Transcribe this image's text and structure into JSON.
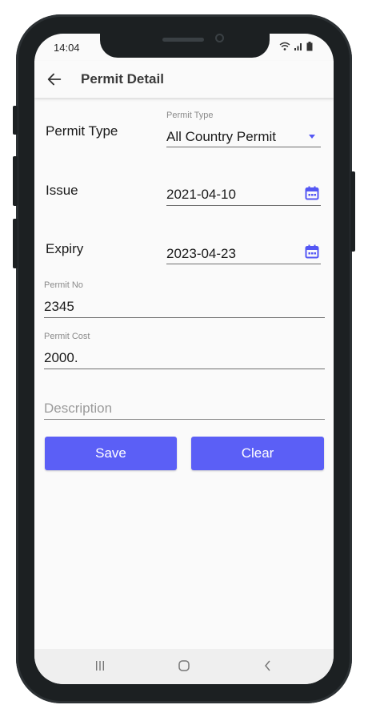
{
  "status": {
    "time": "14:04"
  },
  "appbar": {
    "title": "Permit Detail"
  },
  "form": {
    "permit_type": {
      "label": "Permit Type",
      "caption": "Permit Type",
      "value": "All Country Permit"
    },
    "issue": {
      "label": "Issue",
      "value": "2021-04-10"
    },
    "expiry": {
      "label": "Expiry",
      "value": "2023-04-23"
    },
    "permit_no": {
      "caption": "Permit No",
      "value": "2345"
    },
    "permit_cost": {
      "caption": "Permit Cost",
      "value": "2000."
    },
    "description": {
      "placeholder": "Description",
      "value": ""
    }
  },
  "buttons": {
    "save": "Save",
    "clear": "Clear"
  },
  "colors": {
    "accent": "#5b5ff6",
    "icon": "#5457f4"
  },
  "icons": [
    "back-arrow-icon",
    "calendar-icon",
    "dropdown-arrow-icon",
    "wifi-icon",
    "signal-icon",
    "battery-icon",
    "recents-icon",
    "home-icon",
    "back-nav-icon"
  ]
}
